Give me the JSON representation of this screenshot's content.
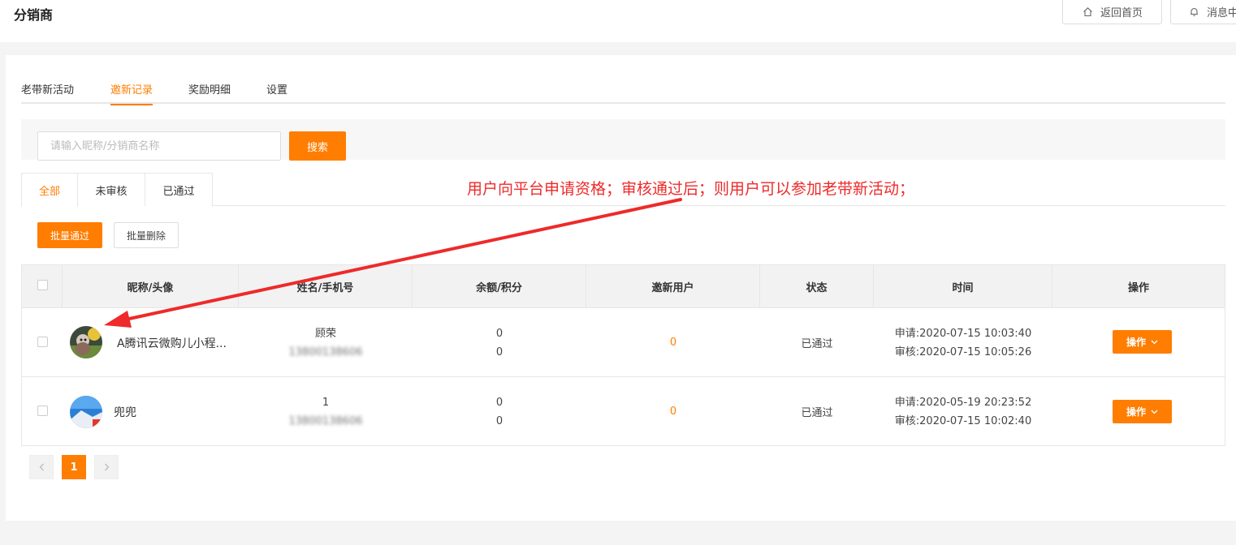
{
  "header": {
    "title": "分销商",
    "home_button": "返回首页",
    "message_button": "消息中"
  },
  "tabs": [
    {
      "label": "老带新活动",
      "active": false
    },
    {
      "label": "邀新记录",
      "active": true
    },
    {
      "label": "奖励明细",
      "active": false
    },
    {
      "label": "设置",
      "active": false
    }
  ],
  "search": {
    "placeholder": "请输入昵称/分销商名称",
    "value": "",
    "button": "搜索"
  },
  "filter_tabs": [
    {
      "label": "全部",
      "active": true
    },
    {
      "label": "未审核",
      "active": false
    },
    {
      "label": "已通过",
      "active": false
    }
  ],
  "batch": {
    "approve": "批量通过",
    "delete": "批量删除"
  },
  "annotation": {
    "text": "用户向平台申请资格；审核通过后；则用户可以参加老带新活动；"
  },
  "table": {
    "columns": [
      "昵称/头像",
      "姓名/手机号",
      "余额/积分",
      "邀新用户",
      "状态",
      "时间",
      "操作"
    ],
    "rows": [
      {
        "nickname": "A腾讯云微购儿小程...",
        "name": "顾荣",
        "phone": "13800138606",
        "balance": "0",
        "points": "0",
        "invited": "0",
        "status": "已通过",
        "apply_time": "申请:2020-07-15 10:03:40",
        "review_time": "审核:2020-07-15 10:05:26",
        "action": "操作"
      },
      {
        "nickname": "兜兜",
        "name": "1",
        "phone": "13800138606",
        "balance": "0",
        "points": "0",
        "invited": "0",
        "status": "已通过",
        "apply_time": "申请:2020-05-19 20:23:52",
        "review_time": "审核:2020-07-15 10:02:40",
        "action": "操作"
      }
    ]
  },
  "pagination": {
    "current": "1",
    "prev_icon": "chevron-left-icon",
    "next_icon": "chevron-right-icon"
  },
  "colors": {
    "accent": "#ff7d00",
    "annotation": "#ee2a2a"
  }
}
